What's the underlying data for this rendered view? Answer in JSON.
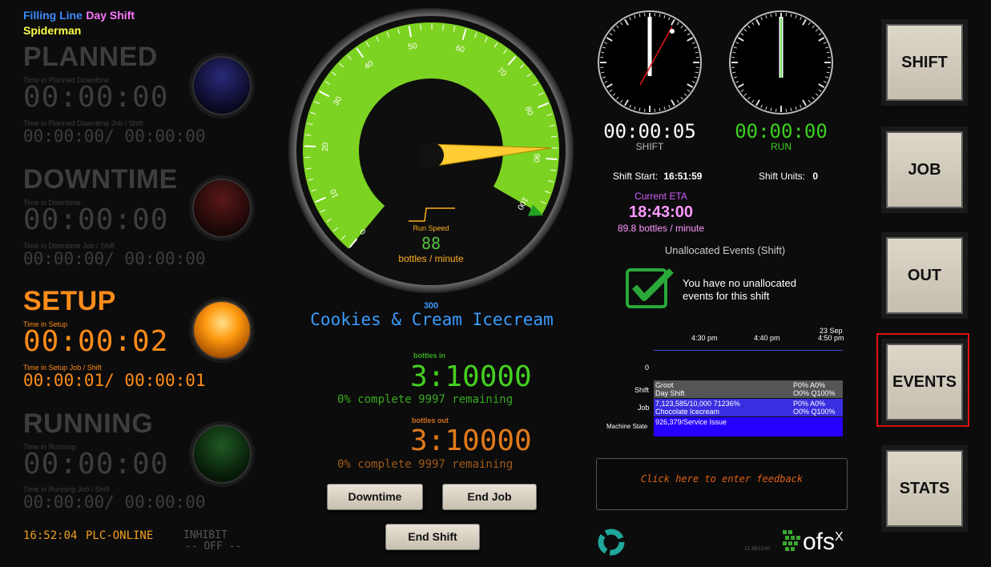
{
  "header": {
    "line": "Filling Line",
    "shift": "Day Shift",
    "operator": "Spiderman"
  },
  "states": {
    "planned": {
      "title": "PLANNED",
      "lbl1": "Time in Planned Downtime",
      "time": "00:00:00",
      "lbl2": "Time in Planned Downtime Job / Shift",
      "job_shift": "00:00:00/ 00:00:00"
    },
    "downtime": {
      "title": "DOWNTIME",
      "lbl1": "Time in Downtime",
      "time": "00:00:00",
      "lbl2": "Time in Downtime Job / Shift",
      "job_shift": "00:00:00/ 00:00:00"
    },
    "setup": {
      "title": "SETUP",
      "lbl1": "Time in Setup",
      "time": "00:00:02",
      "lbl2": "Time in Setup Job / Shift",
      "job_shift": "00:00:01/ 00:00:01"
    },
    "running": {
      "title": "RUNNING",
      "lbl1": "Time in Running",
      "time": "00:00:00",
      "lbl2": "Time in Running Job / Shift",
      "job_shift": "00:00:00/ 00:00:00"
    }
  },
  "footer": {
    "clock": "16:52:04",
    "plc": "PLC-ONLINE",
    "inhibit": "INHIBIT",
    "inhibit_state": "-- OFF --",
    "version": "11.bb11e0"
  },
  "gauge": {
    "ticks": [
      "0",
      "10",
      "20",
      "30",
      "40",
      "50",
      "60",
      "70",
      "80",
      "90",
      "100"
    ],
    "value": 88,
    "max_marker": 100,
    "run_speed_label": "Run Speed",
    "run_speed_value": "88",
    "unit": "bottles / minute"
  },
  "product": {
    "code": "300",
    "name": "Cookies & Cream Icecream"
  },
  "counts": {
    "in_label": "bottles in",
    "in_value": "3:10000",
    "in_status": "0% complete 9997 remaining",
    "out_label": "bottles out",
    "out_value": "3:10000",
    "out_status": "0% complete 9997 remaining"
  },
  "buttons": {
    "downtime": "Downtime",
    "end_job": "End Job",
    "end_shift": "End Shift"
  },
  "clocks": {
    "shift_time": "00:00:05",
    "shift_label": "SHIFT",
    "run_time": "00:00:00",
    "run_label": "RUN"
  },
  "shift_info": {
    "start_label": "Shift Start:",
    "start_value": "16:51:59",
    "units_label": "Shift Units:",
    "units_value": "0",
    "eta_label": "Current ETA",
    "eta_value": "18:43:00",
    "eta_rate": "89.8 bottles / minute"
  },
  "events": {
    "title": "Unallocated Events (Shift)",
    "message": "You have no unallocated events for this shift"
  },
  "timeline": {
    "t1": "4:30 pm",
    "t2": "4:40 pm",
    "t3_date": "23 Sep",
    "t3": "4:50 pm",
    "zero": "0",
    "shift_label": "Shift",
    "job_label": "Job",
    "machine_label": "Machine State",
    "shift_l1": "Groot",
    "shift_l2": "Day Shift",
    "shift_r1": "P0% A0%",
    "shift_r2": "O0% Q100%",
    "job_l1": "7,123,585/10,000 71236%",
    "job_l2": "Chocolate Icecream",
    "job_r1": "P0% A0%",
    "job_r2": "O0% Q100%",
    "machine_state": "926,379/Service Issue"
  },
  "feedback": {
    "placeholder": "Click here to enter feedback"
  },
  "side_buttons": {
    "shift": "SHIFT",
    "job": "JOB",
    "out": "OUT",
    "events": "EVENTS",
    "stats": "STATS"
  },
  "brand": {
    "logo_text": "ofs",
    "logo_sup": "X"
  },
  "colors": {
    "gauge_green": "#7dd321",
    "needle": "#ffcc33",
    "setup_orange": "#ff8c1a",
    "active_border": "#e01010"
  }
}
